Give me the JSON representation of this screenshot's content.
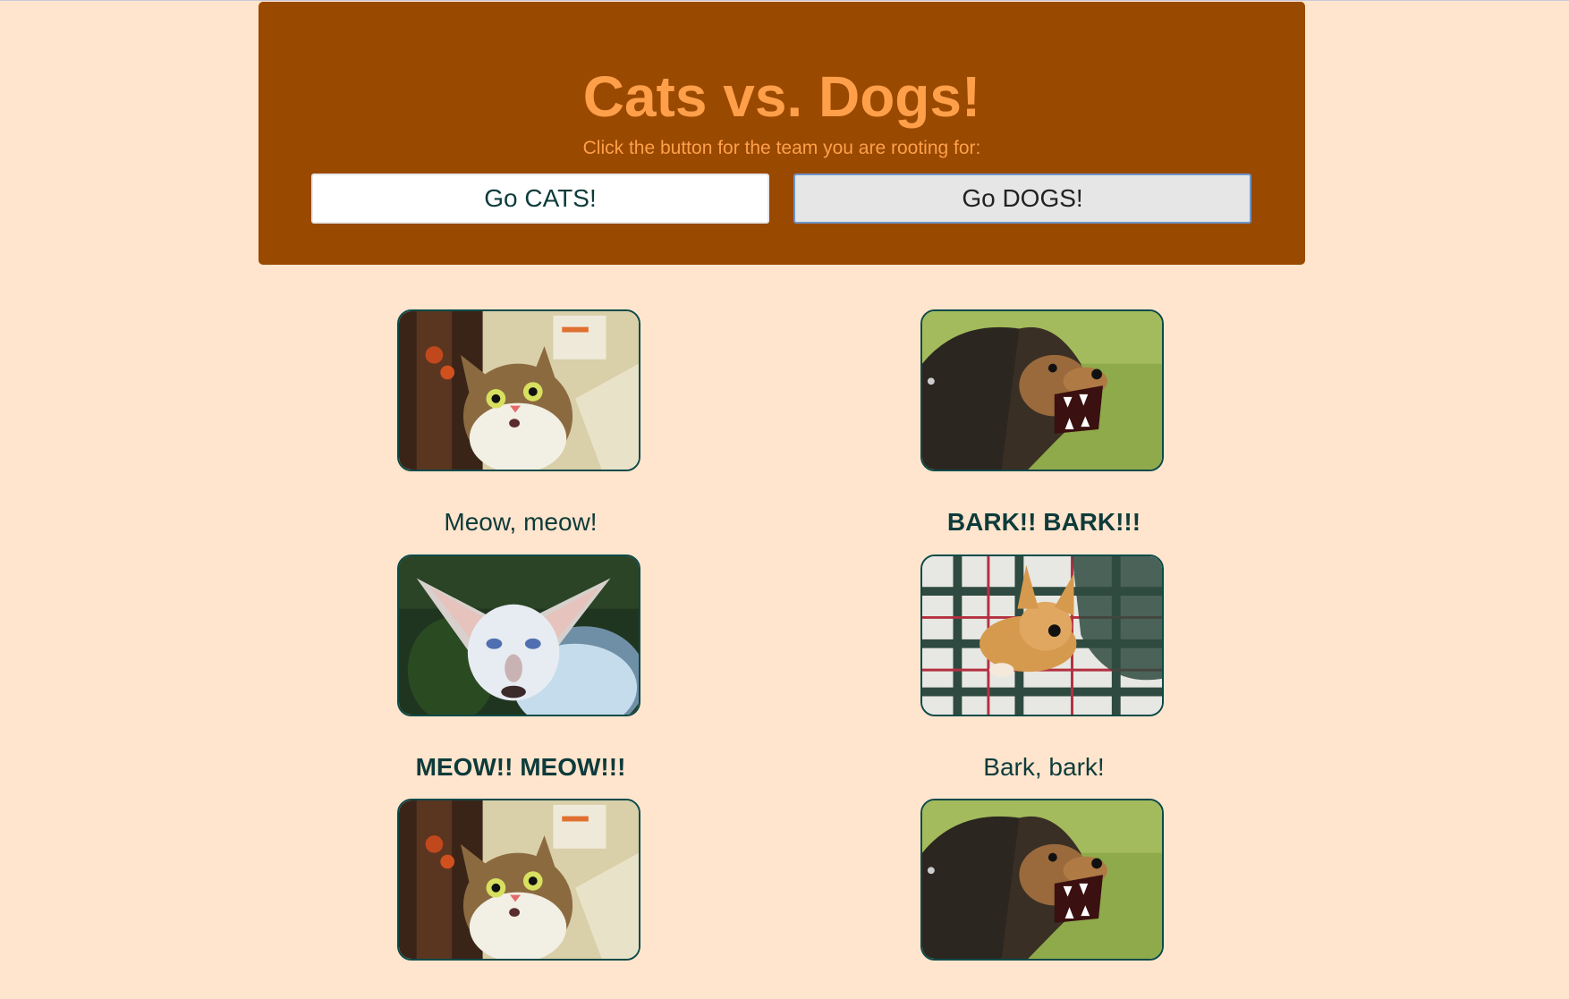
{
  "header": {
    "title": "Cats vs. Dogs!",
    "subtitle": "Click the button for the team you are rooting for:",
    "cats_button_label": "Go CATS!",
    "dogs_button_label": "Go DOGS!"
  },
  "cats": {
    "captions": [
      "Meow, meow!",
      "MEOW!! MEOW!!!"
    ]
  },
  "dogs": {
    "captions": [
      "BARK!! BARK!!!",
      "Bark, bark!"
    ]
  },
  "colors": {
    "page_background": "#ffe5cd",
    "banner_background": "#994900",
    "title_color": "#ff9f4a",
    "text_color": "#0e3b3b",
    "image_border": "#0c4a49"
  }
}
